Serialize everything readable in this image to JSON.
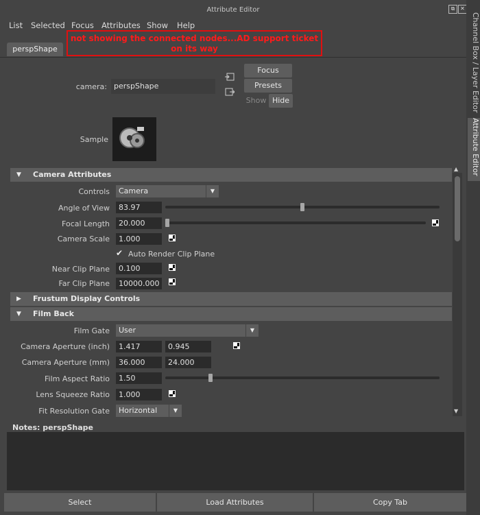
{
  "window": {
    "title": "Attribute Editor"
  },
  "menubar": [
    "List",
    "Selected",
    "Focus",
    "Attributes",
    "Show",
    "Help"
  ],
  "node_tab": "perspShape",
  "annotation": "not showing the connected nodes...AD support ticket on its way",
  "camera_row": {
    "label": "camera:",
    "value": "perspShape"
  },
  "side_buttons": {
    "focus": "Focus",
    "presets": "Presets",
    "show": "Show",
    "hide": "Hide"
  },
  "sample_label": "Sample",
  "sections": {
    "camera_attributes": "Camera Attributes",
    "frustum": "Frustum Display Controls",
    "film_back": "Film Back"
  },
  "camera_attrs": {
    "controls_label": "Controls",
    "controls_value": "Camera",
    "angle_of_view_label": "Angle of View",
    "angle_of_view": "83.97",
    "angle_of_view_slider": 0.5,
    "focal_length_label": "Focal Length",
    "focal_length": "20.000",
    "focal_length_slider": 0.0,
    "camera_scale_label": "Camera Scale",
    "camera_scale": "1.000",
    "auto_render_label": "Auto Render Clip Plane",
    "auto_render_checked": true,
    "near_clip_label": "Near Clip Plane",
    "near_clip": "0.100",
    "far_clip_label": "Far Clip Plane",
    "far_clip": "10000.000"
  },
  "film_back": {
    "film_gate_label": "Film Gate",
    "film_gate": "User",
    "aperture_inch_label": "Camera Aperture (inch)",
    "aperture_inch_x": "1.417",
    "aperture_inch_y": "0.945",
    "aperture_mm_label": "Camera Aperture (mm)",
    "aperture_mm_x": "36.000",
    "aperture_mm_y": "24.000",
    "aspect_label": "Film Aspect Ratio",
    "aspect": "1.50",
    "aspect_slider": 0.16,
    "squeeze_label": "Lens Squeeze Ratio",
    "squeeze": "1.000",
    "fit_gate_label": "Fit Resolution Gate",
    "fit_gate": "Horizontal"
  },
  "notes": {
    "label": "Notes:",
    "node": "perspShape"
  },
  "bottom_buttons": {
    "select": "Select",
    "load": "Load Attributes",
    "copy": "Copy Tab"
  },
  "side_tabs": {
    "channel_box": "Channel Box / Layer Editor",
    "attribute_editor": "Attribute Editor"
  },
  "colors": {
    "annotation": "#e01010",
    "panel": "#444444",
    "field": "#2b2b2b",
    "header": "#5d5d5d"
  }
}
